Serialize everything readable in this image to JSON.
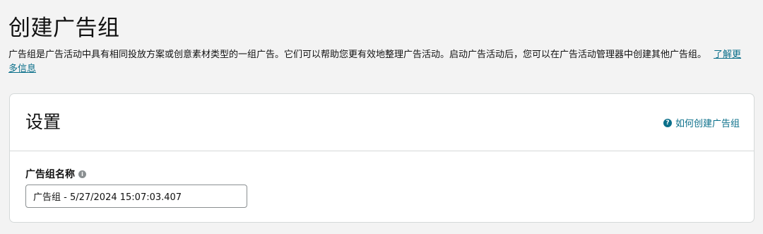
{
  "header": {
    "title": "创建广告组",
    "description": "广告组是广告活动中具有相同投放方案或创意素材类型的一组广告。它们可以帮助您更有效地整理广告活动。启动广告活动后，您可以在广告活动管理器中创建其他广告组。",
    "learn_more": "了解更多信息"
  },
  "settings_card": {
    "title": "设置",
    "help_link": "如何创建广告组",
    "help_icon": "?",
    "field": {
      "label": "广告组名称",
      "info_icon": "i",
      "value": "广告组 - 5/27/2024 15:07:03.407"
    }
  },
  "colors": {
    "page_background": "#f3f3f3",
    "link": "#0a6f8a",
    "border": "#d5d9d9"
  }
}
